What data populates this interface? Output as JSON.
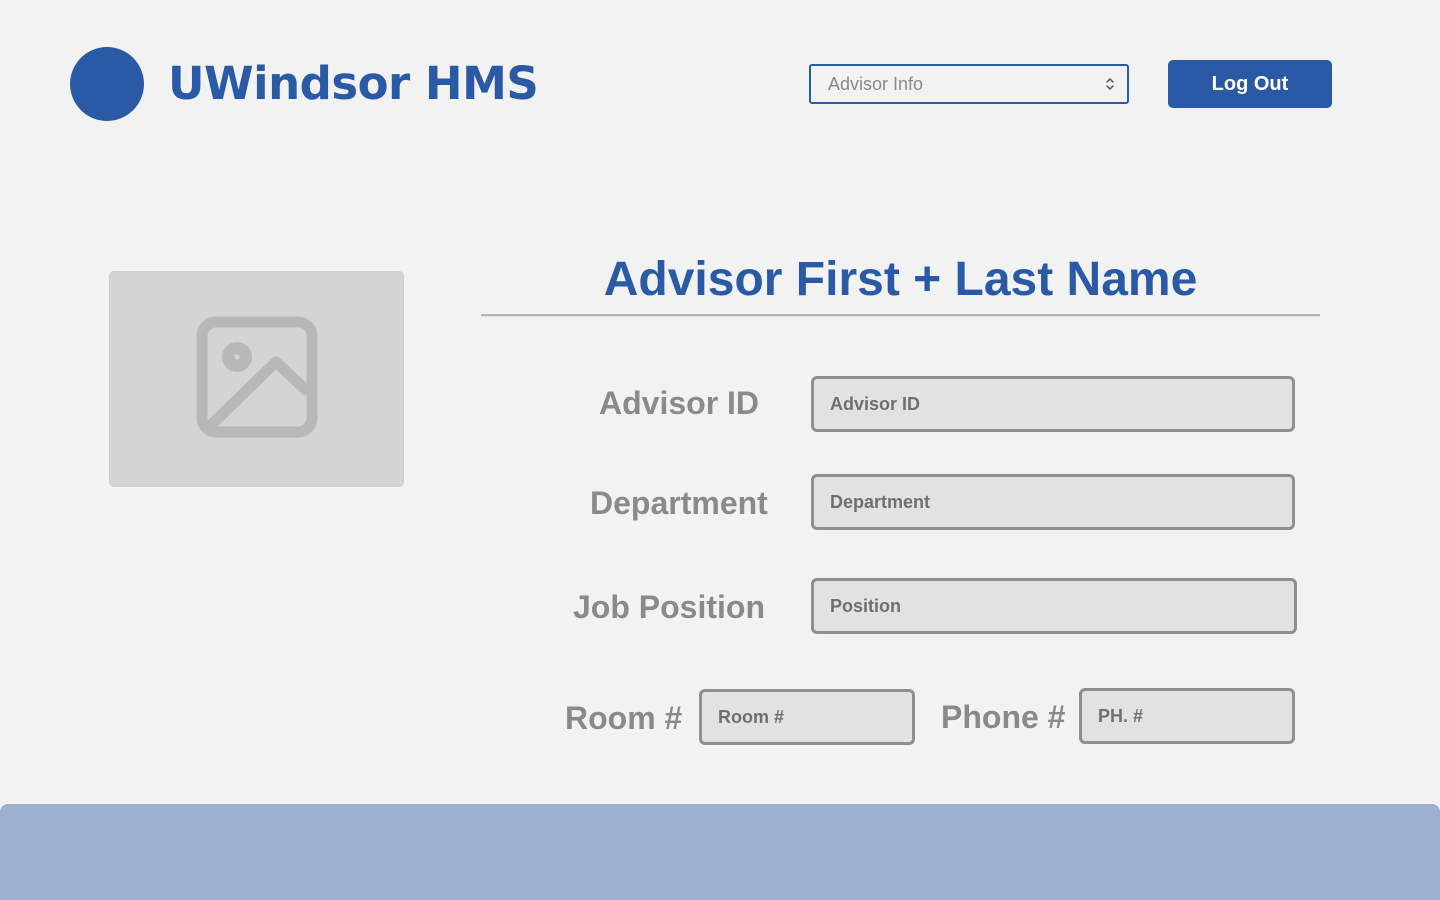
{
  "header": {
    "app_title": "UWindsor HMS",
    "view_select": {
      "value": "Advisor Info",
      "icon": "updown-chevron-icon"
    },
    "logout_label": "Log Out"
  },
  "profile": {
    "photo_icon": "image-placeholder-icon",
    "advisor_name": "Advisor First + Last Name"
  },
  "form": {
    "advisor_id": {
      "label": "Advisor ID",
      "placeholder": "Advisor ID"
    },
    "department": {
      "label": "Department",
      "placeholder": "Department"
    },
    "job_position": {
      "label": "Job Position",
      "placeholder": "Position"
    },
    "room": {
      "label": "Room #",
      "placeholder": "Room #"
    },
    "phone": {
      "label": "Phone #",
      "placeholder": "PH. #"
    }
  },
  "colors": {
    "brand": "#2a5aa6",
    "background": "#f2f2f3",
    "footer": "#9db0d0",
    "label": "#8a8a8a",
    "input_bg": "#e2e2e2",
    "input_border": "#8f8f8f"
  }
}
